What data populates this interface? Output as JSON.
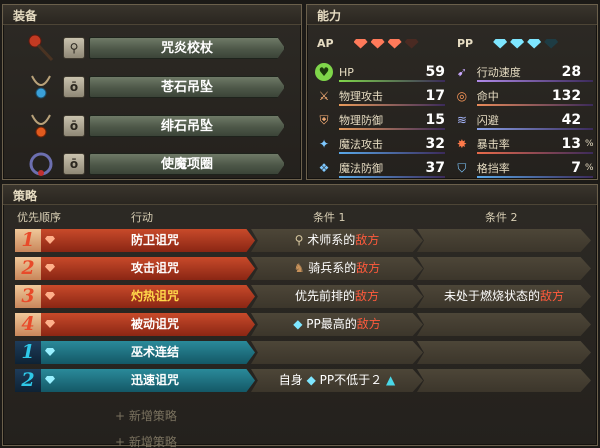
{
  "equipment": {
    "title": "装备",
    "items": [
      {
        "name": "咒炎校杖",
        "slot": "weapon"
      },
      {
        "name": "苍石吊坠",
        "slot": "accessory"
      },
      {
        "name": "绯石吊坠",
        "slot": "accessory"
      },
      {
        "name": "使魔项圈",
        "slot": "accessory"
      }
    ]
  },
  "stats": {
    "title": "能力",
    "ap_label": "AP",
    "pp_label": "PP",
    "ap_filled": 3,
    "ap_total": 4,
    "pp_filled": 3,
    "pp_total": 4,
    "left": [
      {
        "label": "HP",
        "value": "59",
        "unit": ""
      },
      {
        "label": "物理攻击",
        "value": "17",
        "unit": ""
      },
      {
        "label": "物理防御",
        "value": "15",
        "unit": ""
      },
      {
        "label": "魔法攻击",
        "value": "32",
        "unit": ""
      },
      {
        "label": "魔法防御",
        "value": "37",
        "unit": ""
      }
    ],
    "right": [
      {
        "label": "行动速度",
        "value": "28",
        "unit": ""
      },
      {
        "label": "命中",
        "value": "132",
        "unit": ""
      },
      {
        "label": "闪避",
        "value": "42",
        "unit": ""
      },
      {
        "label": "暴击率",
        "value": "13",
        "unit": "%"
      },
      {
        "label": "格挡率",
        "value": "7",
        "unit": "%"
      }
    ]
  },
  "tactics": {
    "title": "策略",
    "headers": {
      "priority": "优先顺序",
      "action": "行动",
      "cond1": "条件 1",
      "cond2": "条件 2"
    },
    "rows": [
      {
        "num": "1",
        "action": "防卫诅咒",
        "cond1_pre": "术师系的",
        "cond1_red": "敌方",
        "cond2": "",
        "cond2_red": ""
      },
      {
        "num": "2",
        "action": "攻击诅咒",
        "cond1_pre": "骑兵系的",
        "cond1_red": "敌方",
        "cond2": "",
        "cond2_red": ""
      },
      {
        "num": "3",
        "action": "灼热诅咒",
        "cond1_pre": "优先前排的",
        "cond1_red": "敌方",
        "cond2": "未处于燃烧状态的",
        "cond2_red": "敌方"
      },
      {
        "num": "4",
        "action": "被动诅咒",
        "cond1_pre": "PP最高的",
        "cond1_red": "敌方",
        "cond2": "",
        "cond2_red": ""
      },
      {
        "num": "1",
        "action": "巫术连结",
        "cond1_pre": "",
        "cond1_red": "",
        "cond2": "",
        "cond2_red": ""
      },
      {
        "num": "2",
        "action": "迅速诅咒",
        "cond1_pre": "自身",
        "cond1_mid": "PP不低于２",
        "cond1_red": "",
        "cond2": "",
        "cond2_red": ""
      }
    ],
    "add_label": "+ 新增策略"
  }
}
